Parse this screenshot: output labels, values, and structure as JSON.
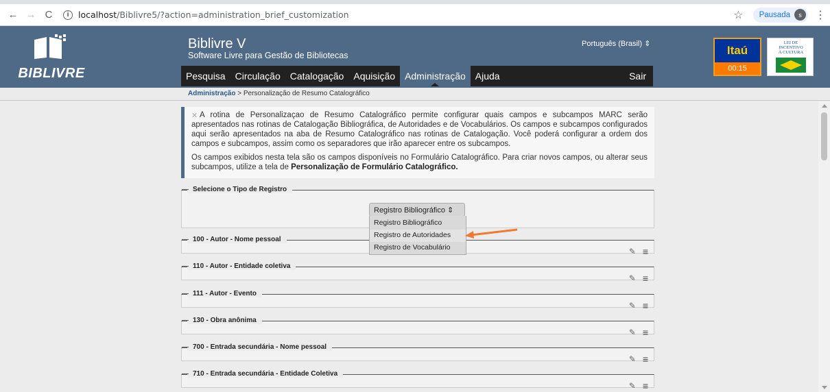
{
  "browser": {
    "url_host": "localhost",
    "url_path": "/Biblivre5/?action=administration_brief_customization",
    "pause_label": "Pausada",
    "avatar_letter": "s"
  },
  "header": {
    "logo_text": "BIBLIVRE",
    "title": "Biblivre V",
    "subtitle": "Software Livre para Gestão de Bibliotecas",
    "language": "Português (Brasil) ⇕",
    "menu": [
      {
        "label": "Pesquisa"
      },
      {
        "label": "Circulação"
      },
      {
        "label": "Catalogação"
      },
      {
        "label": "Aquisição"
      },
      {
        "label": "Administração"
      },
      {
        "label": "Ajuda"
      }
    ],
    "logout": "Sair",
    "itau_logo": "Itaú",
    "itau_timer": "00:15",
    "lei_text": "LEI DE INCENTIVO À CULTURA"
  },
  "breadcrumb": {
    "parent": "Administração",
    "current": " > Personalização de Resumo Catalográfico"
  },
  "info": {
    "paragraph1": "A rotina de Personalizaçao de Resumo Catalográfico permite configurar quais campos e subcampos MARC serão apresentados nas rotinas de Catalogação Bibliográfica, de Autoridades e de Vocabulários. Os campos e subcampos configurados aqui serão apresentados na aba de Resumo Catalográfico nas rotinas de Catalogação. Você poderá configurar a ordem dos campos e subcampos, assim como os separadores que irão aparecer entre os subcampos.",
    "paragraph2_a": "Os campos exibidos nesta tela são os campos disponíveis no Formulário Catalográfico. Para criar novos campos, ou alterar seus subcampos, utilize a tela de ",
    "paragraph2_b": "Personalização de Formulário Catalográfico."
  },
  "record_type": {
    "legend": "Selecione o Tipo de Registro",
    "selected": "Registro Bibliográfico ⇕",
    "options": [
      "Registro Bibliográfico",
      "Registro de Autoridades",
      "Registro de Vocabulário"
    ]
  },
  "fields": [
    {
      "label": "100 - Autor - Nome pessoal"
    },
    {
      "label": "110 - Autor - Entidade coletiva"
    },
    {
      "label": "111 - Autor - Evento"
    },
    {
      "label": "130 - Obra anônima"
    },
    {
      "label": "700 - Entrada secundária - Nome pessoal"
    },
    {
      "label": "710 - Entrada secundária - Entidade Coletiva"
    }
  ],
  "colors": {
    "header_bg": "#4f6a86",
    "menu_bg": "#212121",
    "arrow": "#f07a30"
  },
  "icons": {
    "edit": "pencil-icon",
    "reorder": "hamburger-icon"
  }
}
